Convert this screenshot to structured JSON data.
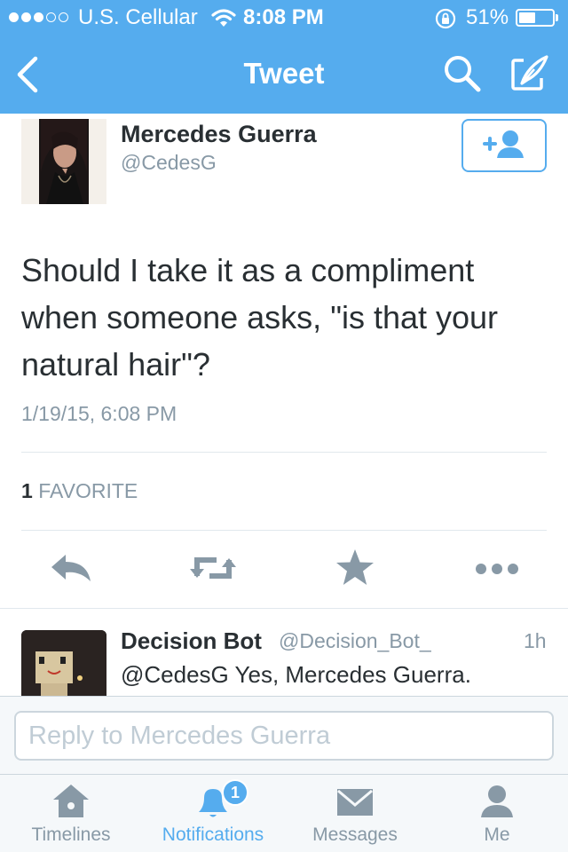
{
  "status_bar": {
    "carrier": "U.S. Cellular",
    "time": "8:08 PM",
    "battery": "51%",
    "battery_level": 0.51,
    "signal_dots_filled": 3,
    "signal_dots_total": 5,
    "icons": [
      "wifi-icon",
      "rotation-lock-icon",
      "battery-icon"
    ]
  },
  "nav": {
    "title": "Tweet",
    "icons": [
      "back-chevron-icon",
      "search-icon",
      "compose-icon"
    ]
  },
  "tweet": {
    "author_name": "Mercedes Guerra",
    "author_handle": "@CedesG",
    "text": "Should I take it as a compliment when someone asks, \"is that your natural hair\"?",
    "date": "1/19/15, 6:08 PM",
    "favorites_count": "1",
    "favorites_label": "FAVORITE",
    "follow_icon": "follow-user-icon",
    "action_icons": [
      "reply-icon",
      "retweet-icon",
      "favorite-star-icon",
      "more-icon"
    ]
  },
  "reply": {
    "name": "Decision Bot",
    "handle": "@Decision_Bot_",
    "time": "1h",
    "text": "@CedesG Yes, Mercedes Guerra."
  },
  "composer": {
    "placeholder": "Reply to Mercedes Guerra",
    "value": ""
  },
  "tabs": [
    {
      "label": "Timelines",
      "icon": "home-icon"
    },
    {
      "label": "Notifications",
      "icon": "bell-icon",
      "badge": "1"
    },
    {
      "label": "Messages",
      "icon": "envelope-icon"
    },
    {
      "label": "Me",
      "icon": "user-icon"
    }
  ],
  "colors": {
    "brand_blue": "#55acee",
    "text_dark": "#292f33",
    "text_muted": "#8899a6",
    "icon_gray": "#8899a6",
    "divider": "#e1e8ed",
    "bar_background": "#f5f8fa"
  }
}
